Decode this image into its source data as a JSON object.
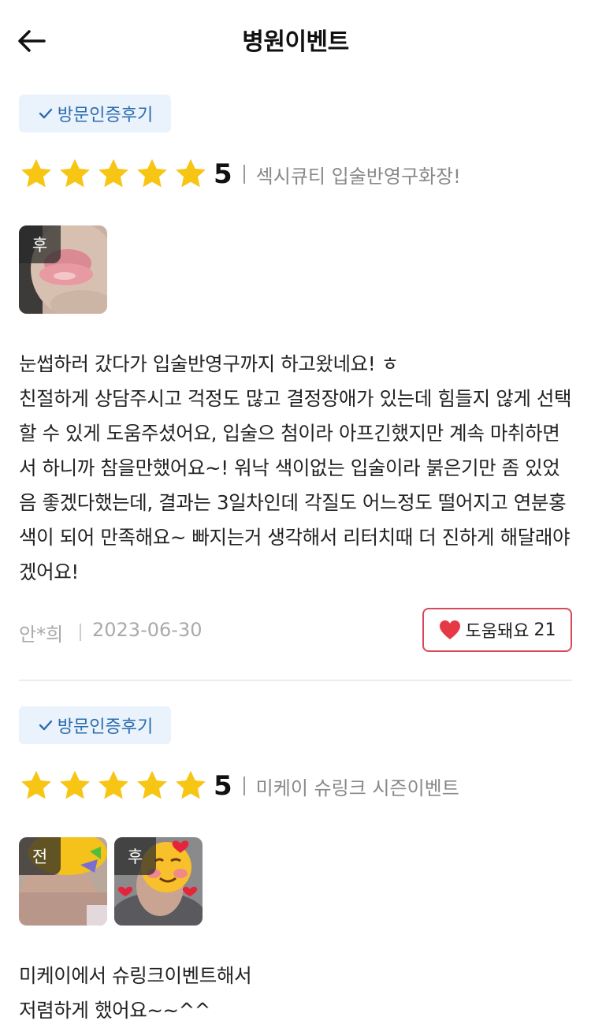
{
  "header": {
    "title": "병원이벤트"
  },
  "reviews": [
    {
      "badge": "방문인증후기",
      "score": "5",
      "stars": 5,
      "event": "섹시큐티 입술반영구화장!",
      "photos": [
        {
          "tag": "후"
        }
      ],
      "text": "눈썹하러 갔다가 입술반영구까지 하고왔네요! ㅎ\n친절하게 상담주시고 걱정도 많고 결정장애가 있는데 힘들지 않게 선택할 수 있게 도움주셨어요, 입술으 첨이라 아프긴했지만 계속 마취하면서 하니까 참을만했어요~! 워낙 색이없는 입술이라 붉은기만 좀 있었음 좋겠다했는데, 결과는 3일차인데 각질도 어느정도 떨어지고 연분홍색이 되어 만족해요~ 빠지는거 생각해서 리터치때 더 진하게 해달래야 겠어요!",
      "author": "안*희",
      "date": "2023-06-30",
      "helpful_label": "도움돼요",
      "helpful_count": "21"
    },
    {
      "badge": "방문인증후기",
      "score": "5",
      "stars": 5,
      "event": "미케이 슈링크 시즌이벤트",
      "photos": [
        {
          "tag": "전"
        },
        {
          "tag": "후"
        }
      ],
      "text": "미케이에서 슈링크이벤트해서\n저렴하게 했어요~~^^"
    }
  ],
  "colors": {
    "badge_bg": "#eaf2fb",
    "badge_text": "#2b6cb0",
    "star": "#f7c514",
    "heart": "#e63946",
    "helpful_border": "#d6495a"
  }
}
